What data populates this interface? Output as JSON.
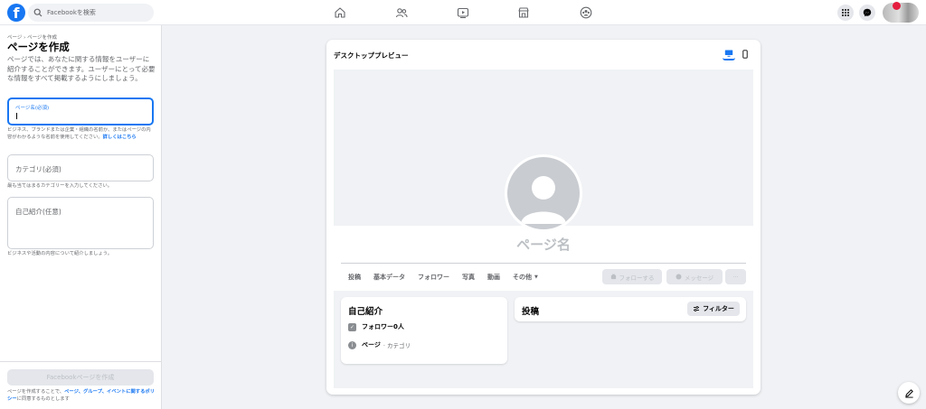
{
  "header": {
    "logo_letter": "f",
    "search_placeholder": "Facebookを検索",
    "nav_icons": [
      "home-icon",
      "friends-icon",
      "watch-icon",
      "marketplace-icon",
      "groups-icon"
    ],
    "right_icons": [
      "menu-grid-icon",
      "messenger-icon",
      "account-avatar"
    ],
    "accent_color": "#1877f2",
    "notification_color": "#e41e3f"
  },
  "sidebar": {
    "breadcrumb": "ページ › ページを作成",
    "title": "ページを作成",
    "description": "ページでは、あなたに関する情報をユーザーに紹介することができます。ユーザーにとって必要な情報をすべて掲載するようにしましょう。",
    "page_name_label": "ページ名(必須)",
    "page_name_value": "",
    "page_name_hint": "ビジネス、ブランドまたは企業・組織の名前か、またはページの内容がわかるような名前を使用してください。",
    "page_name_hint_link": "詳しくはこちら",
    "category_label": "カテゴリ(必須)",
    "category_hint": "最も当てはまるカテゴリーを入力してください。",
    "bio_label": "自己紹介(任意)",
    "bio_hint": "ビジネスや活動の内容について紹介しましょう。",
    "create_button": "Facebookページを作成",
    "terms_prefix": "ページを作成することで、",
    "terms_link": "ページ、グループ、イベントに関するポリシー",
    "terms_suffix": "に同意するものとします"
  },
  "preview": {
    "title": "デスクトッププレビュー",
    "device_icons": [
      "desktop-icon",
      "mobile-icon"
    ],
    "selected_device": "desktop",
    "page_name_placeholder": "ページ名",
    "tabs": [
      "投稿",
      "基本データ",
      "フォロワー",
      "写真",
      "動画",
      "その他"
    ],
    "follow_button": "フォローする",
    "message_button": "メッセージ",
    "more_button": "···",
    "intro": {
      "title": "自己紹介",
      "followers": "フォロワー0人",
      "page_label": "ページ",
      "category": "· カテゴリ"
    },
    "posts": {
      "title": "投稿",
      "filter_button": "フィルター"
    }
  }
}
